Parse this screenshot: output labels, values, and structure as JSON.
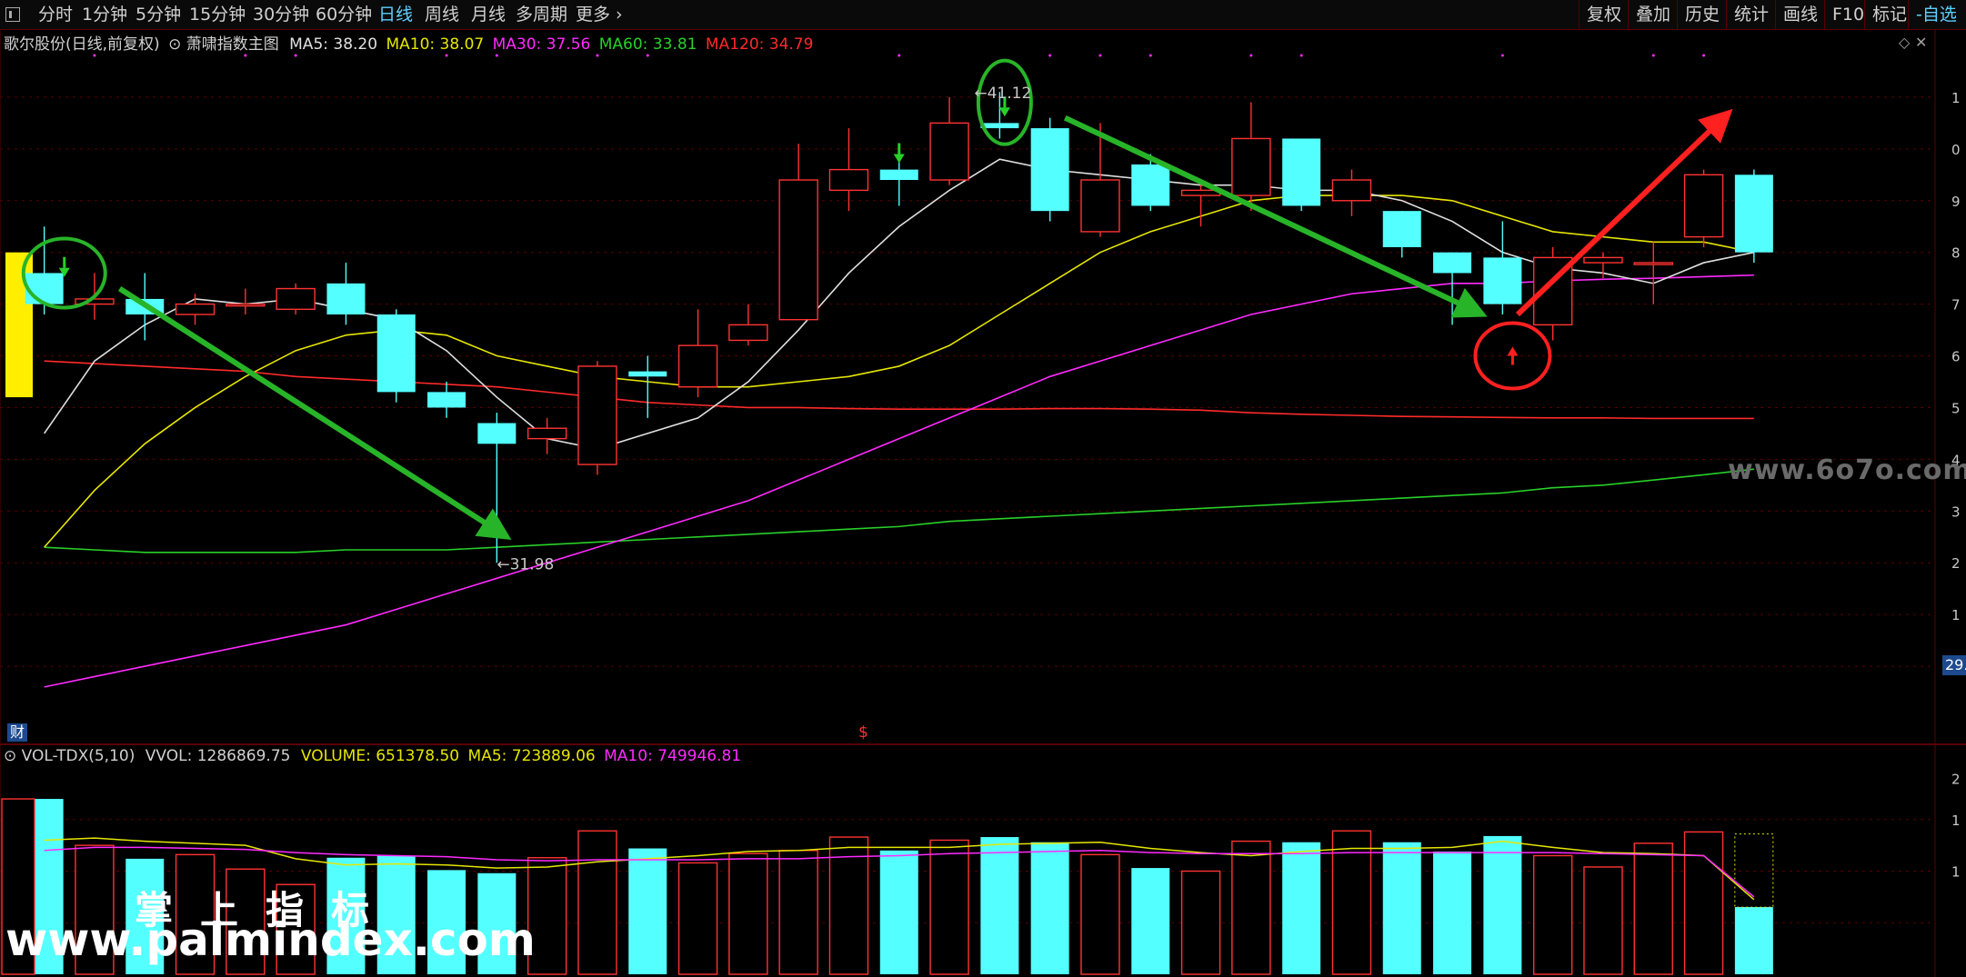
{
  "toolbar": {
    "periods": [
      "分时",
      "1分钟",
      "5分钟",
      "15分钟",
      "30分钟",
      "60分钟",
      "日线",
      "周线",
      "月线",
      "多周期",
      "更多"
    ],
    "active_period": "日线",
    "right_buttons": [
      "复权",
      "叠加",
      "历史",
      "统计",
      "画线",
      "F10",
      "标记",
      "-自选"
    ]
  },
  "main_legend": {
    "stock": "歌尔股份(日线,前复权)",
    "indicator": "萧啸指数主图",
    "ma5": "MA5: 38.20",
    "ma10": "MA10: 38.07",
    "ma30": "MA30: 37.56",
    "ma60": "MA60: 33.81",
    "ma120": "MA120: 34.79"
  },
  "vol_legend": {
    "name": "VOL-TDX(5,10)",
    "vvol": "VVOL: 1286869.75",
    "volume": "VOLUME: 651378.50",
    "ma5": "MA5: 723889.06",
    "ma10": "MA10: 749946.81"
  },
  "annotations": {
    "high_label": "41.12",
    "low_label": "31.98",
    "price_tag": "29.",
    "cai": "财",
    "dollar": "$"
  },
  "watermarks": {
    "site": "www.6o7o.com",
    "cn": "掌上指标",
    "url": "www.palmindex.com"
  },
  "colors": {
    "up": "#ff3232",
    "down": "#54ffff",
    "ma5": "#e0e0e0",
    "ma10": "#e6e600",
    "ma30": "#ff2aff",
    "ma60": "#28d028",
    "ma120": "#ff2a2a",
    "grid": "#5a0000"
  },
  "chart_data": {
    "type": "candlestick",
    "candles": [
      {
        "o": 37.6,
        "c": 37.0,
        "h": 38.5,
        "l": 36.8
      },
      {
        "o": 37.0,
        "c": 37.1,
        "h": 37.6,
        "l": 36.7
      },
      {
        "o": 37.1,
        "c": 36.8,
        "h": 37.6,
        "l": 36.3
      },
      {
        "o": 36.8,
        "c": 37.0,
        "h": 37.2,
        "l": 36.6
      },
      {
        "o": 37.0,
        "c": 37.0,
        "h": 37.3,
        "l": 36.8
      },
      {
        "o": 36.9,
        "c": 37.3,
        "h": 37.4,
        "l": 36.8
      },
      {
        "o": 37.4,
        "c": 36.8,
        "h": 37.8,
        "l": 36.6
      },
      {
        "o": 36.8,
        "c": 35.3,
        "h": 36.9,
        "l": 35.1
      },
      {
        "o": 35.3,
        "c": 35.0,
        "h": 35.5,
        "l": 34.8
      },
      {
        "o": 34.7,
        "c": 34.3,
        "h": 34.9,
        "l": 32.0
      },
      {
        "o": 34.4,
        "c": 34.6,
        "h": 34.8,
        "l": 34.1
      },
      {
        "o": 33.9,
        "c": 35.8,
        "h": 35.9,
        "l": 33.7
      },
      {
        "o": 35.7,
        "c": 35.6,
        "h": 36.0,
        "l": 34.8
      },
      {
        "o": 35.4,
        "c": 36.2,
        "h": 36.9,
        "l": 35.2
      },
      {
        "o": 36.3,
        "c": 36.6,
        "h": 37.0,
        "l": 36.2
      },
      {
        "o": 36.7,
        "c": 39.4,
        "h": 40.1,
        "l": 36.8
      },
      {
        "o": 39.2,
        "c": 39.6,
        "h": 40.4,
        "l": 38.8
      },
      {
        "o": 39.6,
        "c": 39.4,
        "h": 39.8,
        "l": 38.9
      },
      {
        "o": 39.4,
        "c": 40.5,
        "h": 41.0,
        "l": 39.3
      },
      {
        "o": 40.5,
        "c": 40.4,
        "h": 41.1,
        "l": 40.2
      },
      {
        "o": 40.4,
        "c": 38.8,
        "h": 40.6,
        "l": 38.6
      },
      {
        "o": 38.4,
        "c": 39.4,
        "h": 40.5,
        "l": 38.3
      },
      {
        "o": 39.7,
        "c": 38.9,
        "h": 39.9,
        "l": 38.8
      },
      {
        "o": 39.1,
        "c": 39.2,
        "h": 39.4,
        "l": 38.5
      },
      {
        "o": 39.1,
        "c": 40.2,
        "h": 40.9,
        "l": 38.8
      },
      {
        "o": 40.2,
        "c": 38.9,
        "h": 40.2,
        "l": 38.8
      },
      {
        "o": 39.0,
        "c": 39.4,
        "h": 39.6,
        "l": 38.7
      },
      {
        "o": 38.8,
        "c": 38.1,
        "h": 38.8,
        "l": 37.9
      },
      {
        "o": 38.0,
        "c": 37.6,
        "h": 38.0,
        "l": 36.6
      },
      {
        "o": 37.9,
        "c": 37.0,
        "h": 38.6,
        "l": 36.8
      },
      {
        "o": 36.6,
        "c": 37.9,
        "h": 38.1,
        "l": 36.3
      },
      {
        "o": 37.8,
        "c": 37.9,
        "h": 38.0,
        "l": 37.5
      },
      {
        "o": 37.8,
        "c": 37.8,
        "h": 38.2,
        "l": 37.0
      },
      {
        "o": 38.3,
        "c": 39.5,
        "h": 39.6,
        "l": 38.1
      },
      {
        "o": 39.5,
        "c": 38.0,
        "h": 39.6,
        "l": 37.8
      }
    ],
    "ma5": [
      34.5,
      35.9,
      36.6,
      37.1,
      37.0,
      37.1,
      36.9,
      36.7,
      36.1,
      35.2,
      34.4,
      34.2,
      34.5,
      34.8,
      35.5,
      36.5,
      37.6,
      38.5,
      39.2,
      39.8,
      39.6,
      39.5,
      39.4,
      39.3,
      39.3,
      39.2,
      39.2,
      39.0,
      38.6,
      38.0,
      37.7,
      37.6,
      37.4,
      37.8,
      38.0
    ],
    "ma10": [
      32.3,
      33.4,
      34.3,
      35.0,
      35.6,
      36.1,
      36.4,
      36.5,
      36.4,
      36.0,
      35.8,
      35.6,
      35.5,
      35.4,
      35.4,
      35.5,
      35.6,
      35.8,
      36.2,
      36.8,
      37.4,
      38.0,
      38.4,
      38.7,
      39.0,
      39.1,
      39.1,
      39.1,
      39.0,
      38.7,
      38.4,
      38.3,
      38.2,
      38.2,
      38.0
    ],
    "ma30": [
      29.6,
      29.8,
      30.0,
      30.2,
      30.4,
      30.6,
      30.8,
      31.1,
      31.4,
      31.7,
      32.0,
      32.3,
      32.6,
      32.9,
      33.2,
      33.6,
      34.0,
      34.4,
      34.8,
      35.2,
      35.6,
      35.9,
      36.2,
      36.5,
      36.8,
      37.0,
      37.2,
      37.3,
      37.4,
      37.4,
      37.45,
      37.48,
      37.5,
      37.53,
      37.56
    ],
    "ma60": [
      32.3,
      32.25,
      32.2,
      32.2,
      32.2,
      32.2,
      32.25,
      32.25,
      32.25,
      32.3,
      32.35,
      32.4,
      32.45,
      32.5,
      32.55,
      32.6,
      32.65,
      32.7,
      32.8,
      32.85,
      32.9,
      32.95,
      33.0,
      33.05,
      33.1,
      33.15,
      33.2,
      33.25,
      33.3,
      33.35,
      33.45,
      33.5,
      33.6,
      33.7,
      33.81
    ],
    "ma120": [
      35.9,
      35.85,
      35.8,
      35.75,
      35.7,
      35.6,
      35.55,
      35.5,
      35.45,
      35.4,
      35.3,
      35.2,
      35.1,
      35.05,
      35.0,
      35.0,
      34.98,
      34.97,
      34.97,
      34.97,
      34.98,
      34.98,
      34.97,
      34.95,
      34.9,
      34.87,
      34.85,
      34.83,
      34.82,
      34.81,
      34.8,
      34.8,
      34.79,
      34.79,
      34.79
    ],
    "volume": [
      1700000,
      1250000,
      1120000,
      1160000,
      1020000,
      870000,
      1130000,
      1150000,
      1010000,
      980000,
      1130000,
      1390000,
      1220000,
      1080000,
      1170000,
      1200000,
      1330000,
      1200000,
      1300000,
      1330000,
      1280000,
      1160000,
      1030000,
      1000000,
      1290000,
      1280000,
      1390000,
      1280000,
      1190000,
      1340000,
      1150000,
      1040000,
      1270000,
      1380000,
      651378.5
    ],
    "vol_ma5": [
      1300000,
      1320000,
      1290000,
      1270000,
      1250000,
      1120000,
      1060000,
      1070000,
      1060000,
      1030000,
      1040000,
      1090000,
      1120000,
      1150000,
      1190000,
      1200000,
      1230000,
      1230000,
      1230000,
      1260000,
      1270000,
      1280000,
      1220000,
      1180000,
      1150000,
      1190000,
      1220000,
      1220000,
      1230000,
      1290000,
      1230000,
      1180000,
      1170000,
      1150000,
      723889.06
    ],
    "vol_ma10": [
      1200000,
      1230000,
      1230000,
      1220000,
      1210000,
      1180000,
      1160000,
      1150000,
      1140000,
      1110000,
      1100000,
      1110000,
      1110000,
      1110000,
      1120000,
      1120000,
      1140000,
      1150000,
      1170000,
      1180000,
      1190000,
      1200000,
      1180000,
      1170000,
      1170000,
      1170000,
      1180000,
      1180000,
      1180000,
      1180000,
      1180000,
      1170000,
      1160000,
      1150000,
      749946.81
    ],
    "ylim": [
      29,
      42
    ],
    "vol_ylim": [
      0,
      2000000
    ]
  }
}
